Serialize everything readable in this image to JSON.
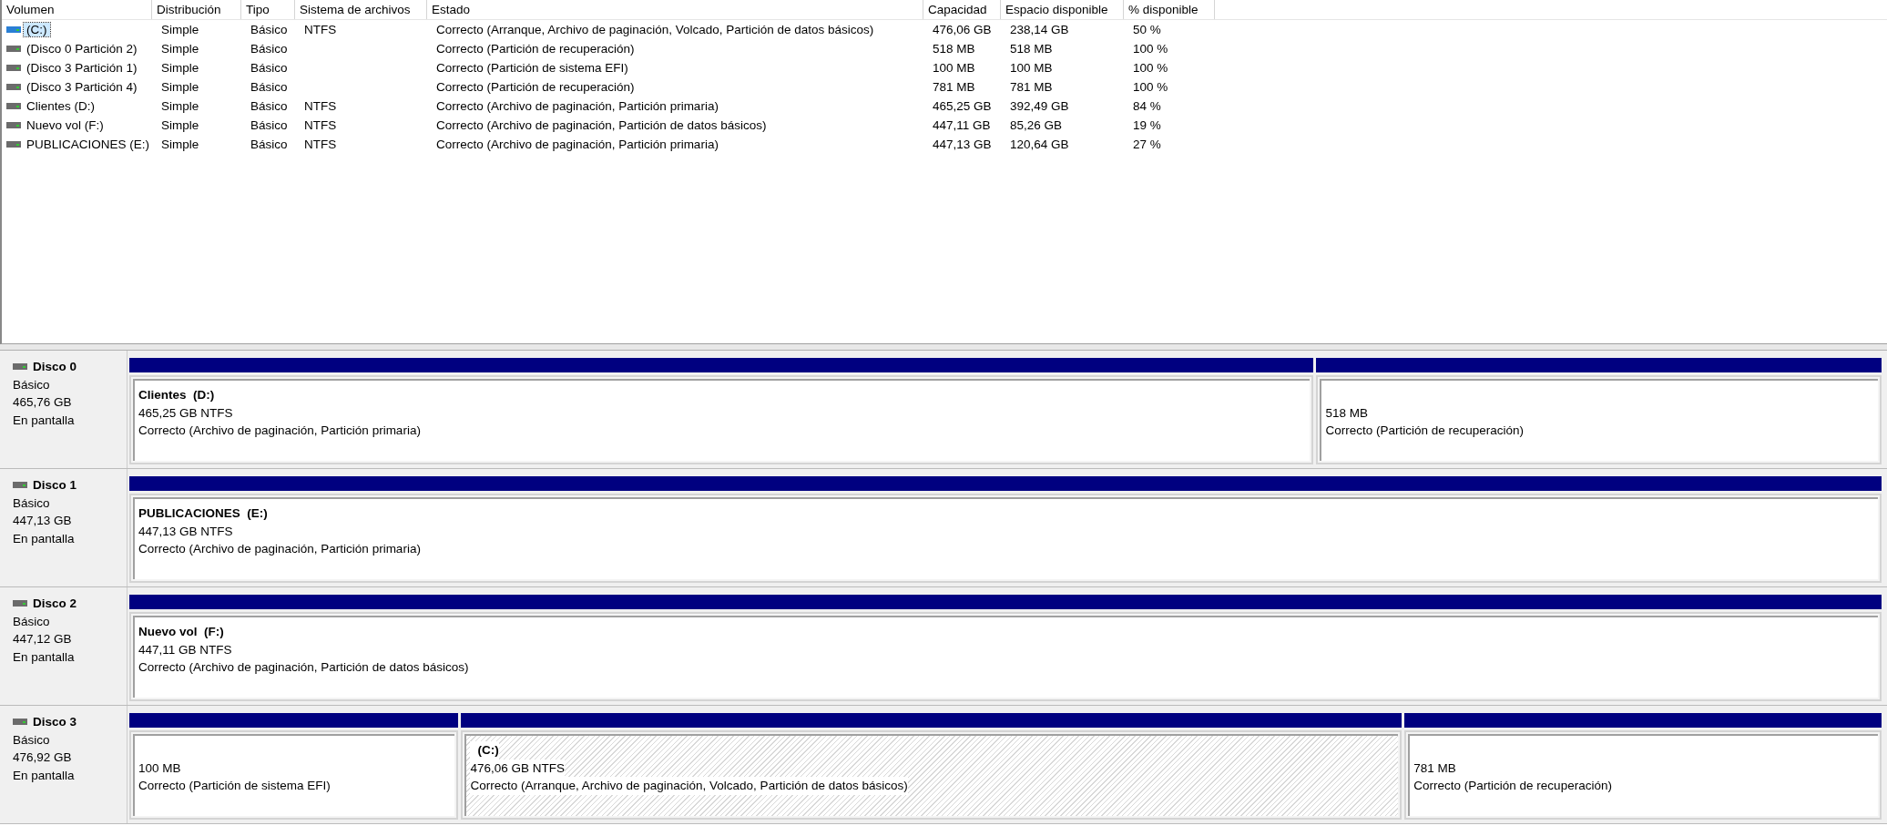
{
  "volume_table": {
    "columns": [
      "Volumen",
      "Distribución",
      "Tipo",
      "Sistema de archivos",
      "Estado",
      "Capacidad",
      "Espacio disponible",
      "% disponible"
    ],
    "rows": [
      {
        "selected": true,
        "cells": [
          "(C:)",
          "Simple",
          "Básico",
          "NTFS",
          "Correcto (Arranque, Archivo de paginación, Volcado, Partición de datos básicos)",
          "476,06 GB",
          "238,14 GB",
          "50 %"
        ]
      },
      {
        "selected": false,
        "cells": [
          "(Disco 0 Partición 2)",
          "Simple",
          "Básico",
          "",
          "Correcto (Partición de recuperación)",
          "518 MB",
          "518 MB",
          "100 %"
        ]
      },
      {
        "selected": false,
        "cells": [
          "(Disco 3 Partición 1)",
          "Simple",
          "Básico",
          "",
          "Correcto (Partición de sistema EFI)",
          "100 MB",
          "100 MB",
          "100 %"
        ]
      },
      {
        "selected": false,
        "cells": [
          "(Disco 3 Partición 4)",
          "Simple",
          "Básico",
          "",
          "Correcto (Partición de recuperación)",
          "781 MB",
          "781 MB",
          "100 %"
        ]
      },
      {
        "selected": false,
        "cells": [
          "Clientes (D:)",
          "Simple",
          "Básico",
          "NTFS",
          "Correcto (Archivo de paginación, Partición primaria)",
          "465,25 GB",
          "392,49 GB",
          "84 %"
        ]
      },
      {
        "selected": false,
        "cells": [
          "Nuevo vol (F:)",
          "Simple",
          "Básico",
          "NTFS",
          "Correcto (Archivo de paginación, Partición de datos básicos)",
          "447,11 GB",
          "85,26 GB",
          "19 %"
        ]
      },
      {
        "selected": false,
        "cells": [
          "PUBLICACIONES (E:)",
          "Simple",
          "Básico",
          "NTFS",
          "Correcto (Archivo de paginación, Partición primaria)",
          "447,13 GB",
          "120,64 GB",
          "27 %"
        ]
      }
    ]
  },
  "disks": [
    {
      "name": "Disco 0",
      "type": "Básico",
      "size": "465,76 GB",
      "state": "En pantalla",
      "partitions": [
        {
          "title": "Clientes  (D:)",
          "size": "465,25 GB NTFS",
          "status": "Correcto (Archivo de paginación, Partición primaria)",
          "selected": false
        },
        {
          "size": "518 MB",
          "status": "Correcto (Partición de recuperación)",
          "selected": false
        }
      ]
    },
    {
      "name": "Disco 1",
      "type": "Básico",
      "size": "447,13 GB",
      "state": "En pantalla",
      "partitions": [
        {
          "title": "PUBLICACIONES  (E:)",
          "size": "447,13 GB NTFS",
          "status": "Correcto (Archivo de paginación, Partición primaria)",
          "selected": false
        }
      ]
    },
    {
      "name": "Disco 2",
      "type": "Básico",
      "size": "447,12 GB",
      "state": "En pantalla",
      "partitions": [
        {
          "title": "Nuevo vol  (F:)",
          "size": "447,11 GB NTFS",
          "status": "Correcto (Archivo de paginación, Partición de datos básicos)",
          "selected": false
        }
      ]
    },
    {
      "name": "Disco 3",
      "type": "Básico",
      "size": "476,92 GB",
      "state": "En pantalla",
      "partitions": [
        {
          "size": "100 MB",
          "status": "Correcto (Partición de sistema EFI)",
          "selected": false
        },
        {
          "title": "(C:)",
          "size": "476,06 GB NTFS",
          "status": "Correcto (Arranque, Archivo de paginación, Volcado, Partición de datos básicos)",
          "selected": true
        },
        {
          "size": "781 MB",
          "status": "Correcto (Partición de recuperación)",
          "selected": false
        }
      ]
    }
  ]
}
